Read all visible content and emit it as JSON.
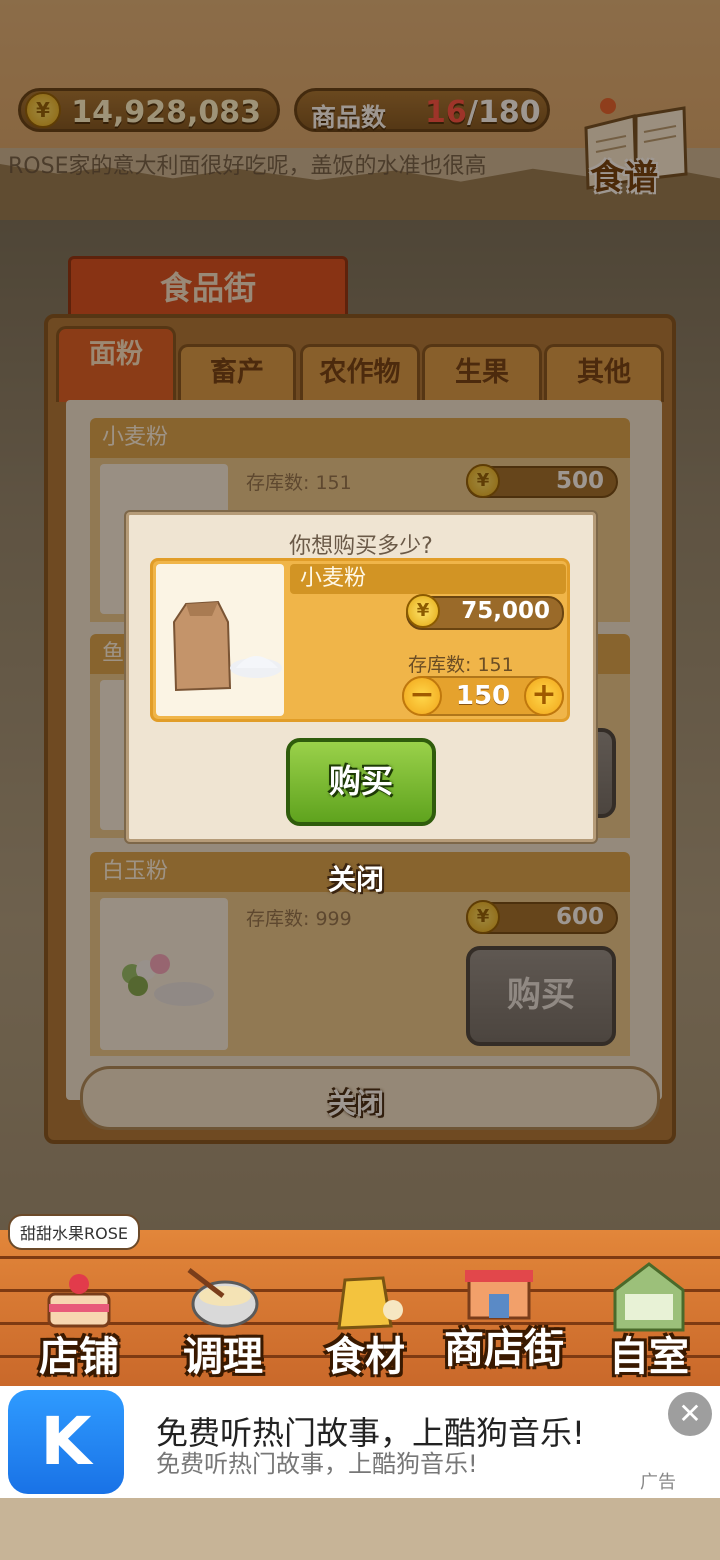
{
  "header": {
    "coins": "14,928,083",
    "goods_label": "商品数",
    "goods_current": "16",
    "goods_total": "/180",
    "ticker": "ROSE家的意大利面很好吃呢，盖饭的水准也很高",
    "recipe_label": "食谱"
  },
  "scene": {
    "street_banner": "食品街"
  },
  "shop": {
    "tabs": [
      "面粉",
      "畜产",
      "农作物",
      "生果",
      "其他"
    ],
    "items": [
      {
        "name": "小麦粉",
        "stock": "存库数: 151",
        "price": "500"
      },
      {
        "name": "鱼",
        "stock": "",
        "price": ""
      },
      {
        "name": "白玉粉",
        "stock": "存库数: 999",
        "price": "600",
        "buy_label": "购买"
      }
    ],
    "close_label": "关闭"
  },
  "dialog": {
    "question": "你想购买多少?",
    "item_name": "小麦粉",
    "total_price": "75,000",
    "stock": "存库数: 151",
    "quantity": "150",
    "minus": "−",
    "plus": "+",
    "buy_label": "购买",
    "close_label": "关闭"
  },
  "nav": {
    "shop_name": "甜甜水果ROSE",
    "items": [
      "店铺",
      "调理",
      "食材",
      "商店街",
      "自室"
    ]
  },
  "ad": {
    "logo_letter": "K",
    "title": "免费听热门故事，上酷狗音乐!",
    "subtitle": "免费听热门故事，上酷狗音乐!",
    "tag": "广告",
    "close": "✕"
  },
  "colors": {
    "tab_active": "#dd5a22",
    "buy_green": "#5fa31e",
    "price_red": "#ff4b43",
    "ad_blue": "#1972e6"
  }
}
